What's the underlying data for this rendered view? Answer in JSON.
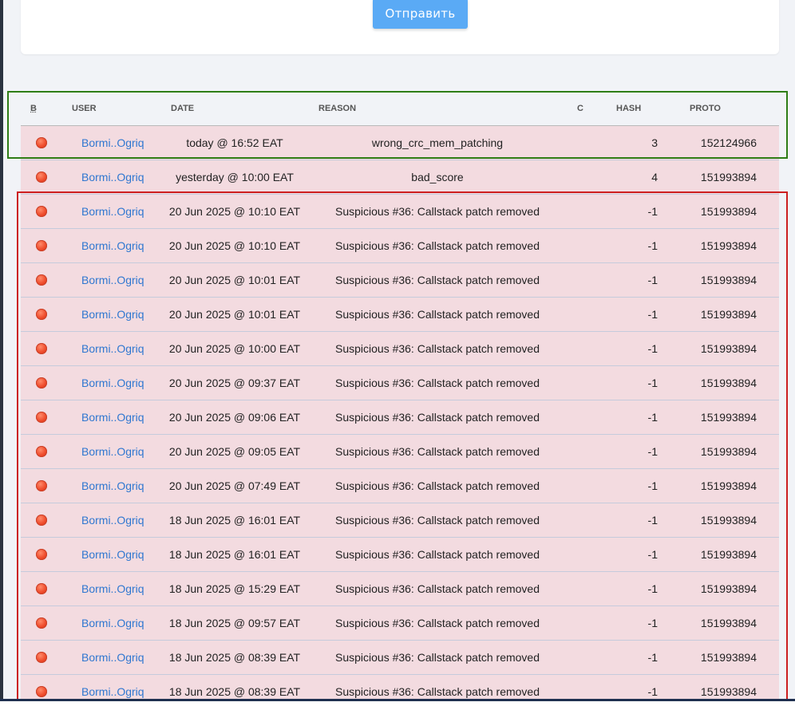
{
  "form": {
    "submit_label": "Отправить"
  },
  "table": {
    "headers": {
      "b": "B",
      "user": "USER",
      "date": "DATE",
      "reason": "REASON",
      "c": "C",
      "hash": "HASH",
      "proto": "PROTO"
    },
    "rows": [
      {
        "user": "Bormi..Ogriq",
        "date": "today @ 16:52 EAT",
        "reason": "wrong_crc_mem_patching",
        "hash": "3",
        "proto": "152124966"
      },
      {
        "user": "Bormi..Ogriq",
        "date": "yesterday @ 10:00 EAT",
        "reason": "bad_score",
        "hash": "4",
        "proto": "151993894"
      },
      {
        "user": "Bormi..Ogriq",
        "date": "20 Jun 2025 @ 10:10 EAT",
        "reason": "Suspicious #36: Callstack patch removed",
        "hash": "-1",
        "proto": "151993894"
      },
      {
        "user": "Bormi..Ogriq",
        "date": "20 Jun 2025 @ 10:10 EAT",
        "reason": "Suspicious #36: Callstack patch removed",
        "hash": "-1",
        "proto": "151993894"
      },
      {
        "user": "Bormi..Ogriq",
        "date": "20 Jun 2025 @ 10:01 EAT",
        "reason": "Suspicious #36: Callstack patch removed",
        "hash": "-1",
        "proto": "151993894"
      },
      {
        "user": "Bormi..Ogriq",
        "date": "20 Jun 2025 @ 10:01 EAT",
        "reason": "Suspicious #36: Callstack patch removed",
        "hash": "-1",
        "proto": "151993894"
      },
      {
        "user": "Bormi..Ogriq",
        "date": "20 Jun 2025 @ 10:00 EAT",
        "reason": "Suspicious #36: Callstack patch removed",
        "hash": "-1",
        "proto": "151993894"
      },
      {
        "user": "Bormi..Ogriq",
        "date": "20 Jun 2025 @ 09:37 EAT",
        "reason": "Suspicious #36: Callstack patch removed",
        "hash": "-1",
        "proto": "151993894"
      },
      {
        "user": "Bormi..Ogriq",
        "date": "20 Jun 2025 @ 09:06 EAT",
        "reason": "Suspicious #36: Callstack patch removed",
        "hash": "-1",
        "proto": "151993894"
      },
      {
        "user": "Bormi..Ogriq",
        "date": "20 Jun 2025 @ 09:05 EAT",
        "reason": "Suspicious #36: Callstack patch removed",
        "hash": "-1",
        "proto": "151993894"
      },
      {
        "user": "Bormi..Ogriq",
        "date": "20 Jun 2025 @ 07:49 EAT",
        "reason": "Suspicious #36: Callstack patch removed",
        "hash": "-1",
        "proto": "151993894"
      },
      {
        "user": "Bormi..Ogriq",
        "date": "18 Jun 2025 @ 16:01 EAT",
        "reason": "Suspicious #36: Callstack patch removed",
        "hash": "-1",
        "proto": "151993894"
      },
      {
        "user": "Bormi..Ogriq",
        "date": "18 Jun 2025 @ 16:01 EAT",
        "reason": "Suspicious #36: Callstack patch removed",
        "hash": "-1",
        "proto": "151993894"
      },
      {
        "user": "Bormi..Ogriq",
        "date": "18 Jun 2025 @ 15:29 EAT",
        "reason": "Suspicious #36: Callstack patch removed",
        "hash": "-1",
        "proto": "151993894"
      },
      {
        "user": "Bormi..Ogriq",
        "date": "18 Jun 2025 @ 09:57 EAT",
        "reason": "Suspicious #36: Callstack patch removed",
        "hash": "-1",
        "proto": "151993894"
      },
      {
        "user": "Bormi..Ogriq",
        "date": "18 Jun 2025 @ 08:39 EAT",
        "reason": "Suspicious #36: Callstack patch removed",
        "hash": "-1",
        "proto": "151993894"
      },
      {
        "user": "Bormi..Ogriq",
        "date": "18 Jun 2025 @ 08:39 EAT",
        "reason": "Suspicious #36: Callstack patch removed",
        "hash": "-1",
        "proto": "151993894"
      }
    ]
  },
  "colors": {
    "row_background": "#f3dbe0",
    "status_dot": "#ee4a2a",
    "link": "#2f77d0",
    "submit_button": "#5aaaf5",
    "highlight_green": "#2e7d16",
    "highlight_red": "#cc1f1f"
  }
}
